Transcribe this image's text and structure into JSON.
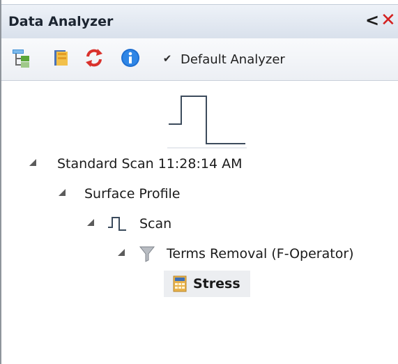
{
  "window": {
    "title": "Data Analyzer",
    "pin_glyph": "<",
    "close_glyph": "✕",
    "colors": {
      "close": "#d3201f",
      "titlebar": "#dfe6ef"
    }
  },
  "toolbar": {
    "icons": [
      "tree-view-icon",
      "folder-icon",
      "refresh-icon",
      "info-icon"
    ],
    "checkbox_mark": "✔",
    "checkbox_label": "Default Analyzer",
    "checkbox_checked": true
  },
  "tree": {
    "nodes": [
      {
        "label": "Standard Scan 11:28:14 AM",
        "expanded": true
      },
      {
        "label": "Surface Profile",
        "expanded": true
      },
      {
        "label": "Scan",
        "expanded": true,
        "icon": "profile-step-icon"
      },
      {
        "label": "Terms Removal (F-Operator)",
        "expanded": true,
        "icon": "filter-funnel-icon"
      },
      {
        "label": "Stress",
        "selected": true,
        "icon": "calculator-icon"
      }
    ]
  }
}
